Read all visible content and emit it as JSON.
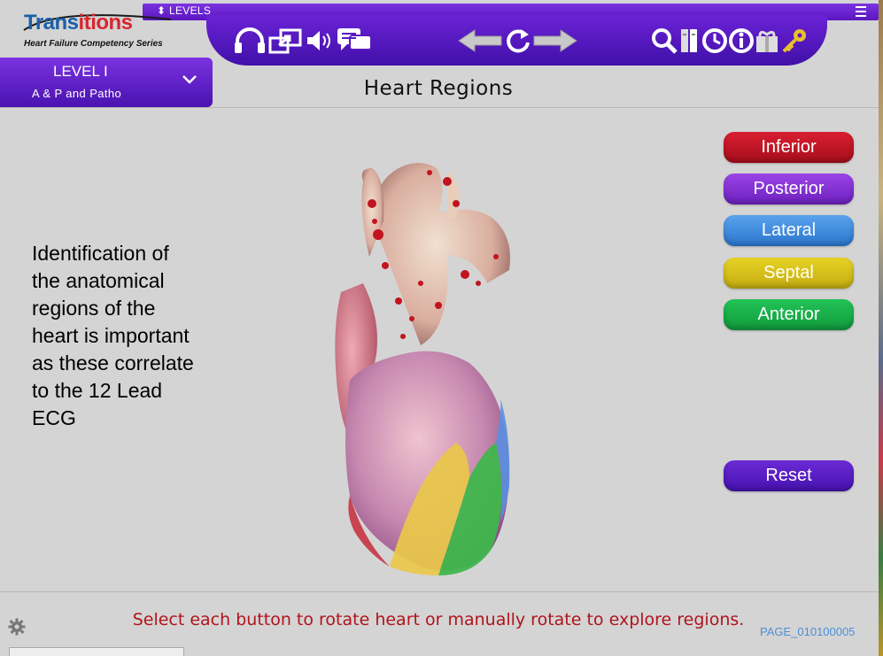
{
  "topbar": {
    "levels_label": "⬍ LEVELS"
  },
  "logo": {
    "main_a": "Trans",
    "main_b": "itions",
    "sub": "Heart Failure Competency Series"
  },
  "level": {
    "title": "LEVEL I",
    "subtitle": "A & P and Patho"
  },
  "page_title": "Heart Regions",
  "description": "Identification of the anatomical regions of the heart is important as these correlate to the 12 Lead ECG",
  "regions": [
    {
      "label": "Inferior",
      "color": "#c21424"
    },
    {
      "label": "Posterior",
      "color": "#8a2fd6"
    },
    {
      "label": "Lateral",
      "color": "#3d8ee0"
    },
    {
      "label": "Septal",
      "color": "#d6c21a"
    },
    {
      "label": "Anterior",
      "color": "#16b04a"
    }
  ],
  "reset_label": "Reset",
  "instruction": "Select each button to rotate heart or manually rotate to explore regions.",
  "page_id": "PAGE_010100005",
  "toolbar_icons": [
    "headphones-icon",
    "resize-icon",
    "volume-icon",
    "chat-icon",
    "back-arrow-icon",
    "reload-icon",
    "forward-arrow-icon",
    "search-icon",
    "book-icon",
    "history-icon",
    "info-icon",
    "gift-icon",
    "key-icon"
  ]
}
